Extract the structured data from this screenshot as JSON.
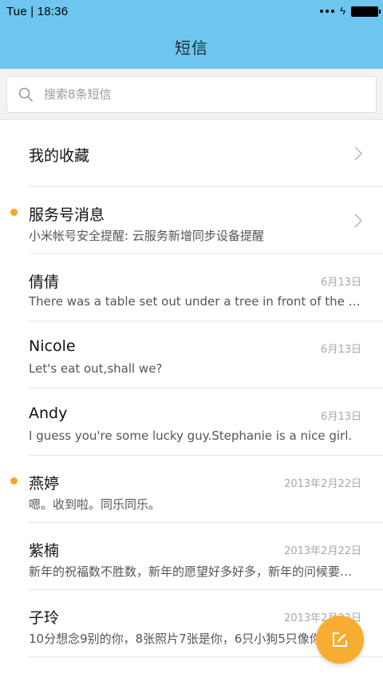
{
  "status_bar": {
    "time": "Tue  |  18:36"
  },
  "header": {
    "title": "短信"
  },
  "search": {
    "placeholder": "搜索8条短信",
    "value": ""
  },
  "favorites": {
    "label": "我的收藏"
  },
  "service": {
    "label": "服务号消息",
    "preview": "小米帐号安全提醒: 云服务新增同步设备提醒",
    "unread": true
  },
  "conversations": [
    {
      "name": "倩倩",
      "preview": "There was a table set out under a tree in front of the house, and the March Hare and the Hatter were having tea at it",
      "date": "6月13日",
      "unread": false
    },
    {
      "name": "Nicole",
      "preview": "Let's eat out,shall we?",
      "date": "6月13日",
      "unread": false
    },
    {
      "name": "Andy",
      "preview": "I guess you're some lucky guy.Stephanie is a nice girl.",
      "date": "6月13日",
      "unread": false
    },
    {
      "name": "燕婷",
      "preview": "嗯。收到啦。同乐同乐。",
      "date": "2013年2月22日",
      "unread": true
    },
    {
      "name": "紫楠",
      "preview": "新年的祝福数不胜数，新年的愿望好多好多，新年的问候要送出",
      "date": "2013年2月22日",
      "unread": false
    },
    {
      "name": "子玲",
      "preview": "10分想念9别的你，8张照片7张是你，6只小狗5只像你",
      "date": "2013年2月22日",
      "unread": false
    }
  ],
  "colors": {
    "header_bg": "#6ec6ee",
    "unread_dot": "#f5a623",
    "fab_bg": "#f7ad2f"
  },
  "icons": {
    "search": "search-icon",
    "chevron": "chevron-right-icon",
    "compose": "compose-icon"
  }
}
